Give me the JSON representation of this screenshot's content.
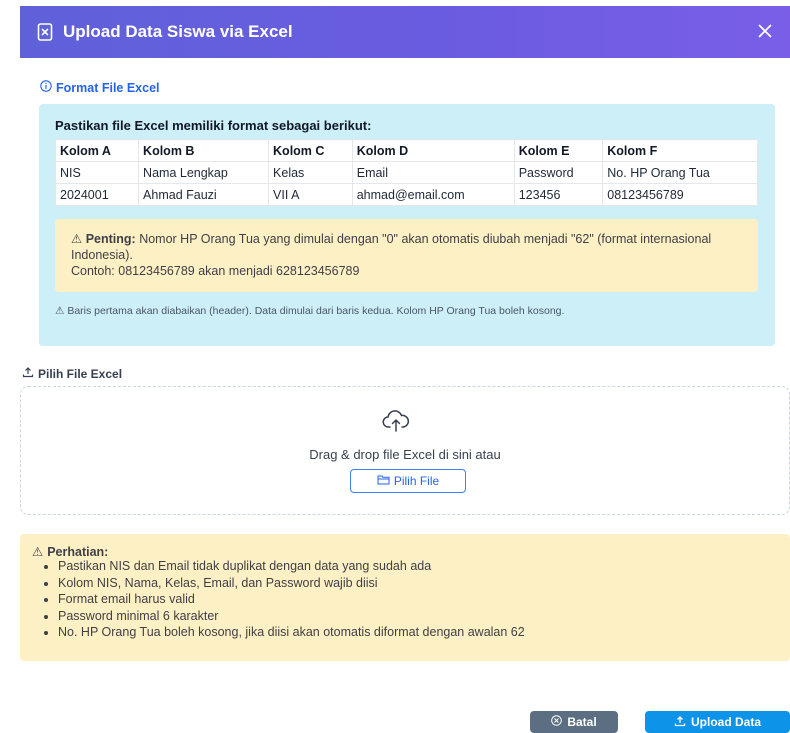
{
  "dialog": {
    "title": "Upload Data Siswa via Excel"
  },
  "format": {
    "title": "Format File Excel",
    "intro": "Pastikan file Excel memiliki format sebagai berikut:",
    "columns": [
      "Kolom A",
      "Kolom B",
      "Kolom C",
      "Kolom D",
      "Kolom E",
      "Kolom F"
    ],
    "rows": [
      [
        "NIS",
        "Nama Lengkap",
        "Kelas",
        "Email",
        "Password",
        "No. HP Orang Tua"
      ],
      [
        "2024001",
        "Ahmad Fauzi",
        "VII A",
        "ahmad@email.com",
        "123456",
        "08123456789"
      ]
    ],
    "important_label": "Penting:",
    "important_text": "Nomor HP Orang Tua yang dimulai dengan \"0\" akan otomatis diubah menjadi \"62\" (format internasional Indonesia).",
    "example_text": "Contoh: 08123456789 akan menjadi 628123456789",
    "note": "Baris pertama akan diabaikan (header). Data dimulai dari baris kedua. Kolom HP Orang Tua boleh kosong."
  },
  "upload": {
    "title": "Pilih File Excel",
    "drop_text": "Drag & drop file Excel di sini atau",
    "pick_button": "Pilih File"
  },
  "attention": {
    "title": "Perhatian:",
    "items": [
      "Pastikan NIS dan Email tidak duplikat dengan data yang sudah ada",
      "Kolom NIS, Nama, Kelas, Email, dan Password wajib diisi",
      "Format email harus valid",
      "Password minimal 6 karakter",
      "No. HP Orang Tua boleh kosong, jika diisi akan otomatis diformat dengan awalan 62"
    ]
  },
  "footer": {
    "cancel_label": "Batal",
    "upload_label": "Upload Data"
  },
  "colors": {
    "header": "#6a5ce0",
    "info_bg": "#cdeff8",
    "warning_bg": "#fdf0c4",
    "primary": "#0d93e8",
    "secondary": "#5c6f82"
  },
  "icons": {
    "title": "file-excel-icon",
    "close": "close-icon",
    "info": "info-icon",
    "warning": "warning-icon",
    "upload": "upload-icon",
    "cloud": "cloud-upload-icon",
    "folder": "folder-icon",
    "cancel": "cancel-circle-icon"
  }
}
